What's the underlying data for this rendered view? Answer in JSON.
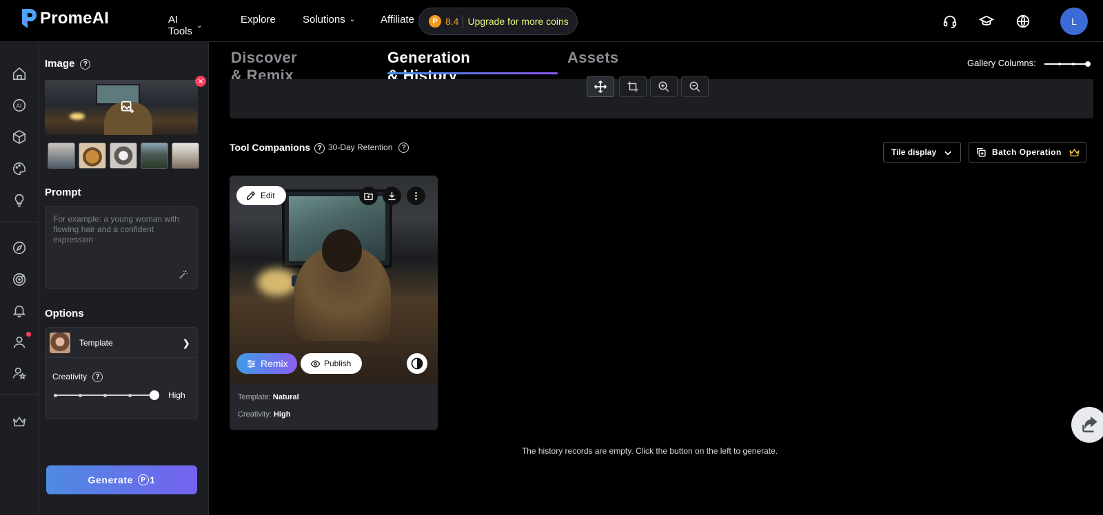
{
  "brand": {
    "name": "PromeAI"
  },
  "nav": {
    "items": [
      {
        "label": "AI Tools",
        "has_dropdown": true
      },
      {
        "label": "Explore",
        "has_dropdown": false
      },
      {
        "label": "Solutions",
        "has_dropdown": true
      },
      {
        "label": "Affiliate",
        "has_dropdown": false
      }
    ],
    "coins": "8.4",
    "upgrade_label": "Upgrade for more coins",
    "icons": [
      "headset-icon",
      "graduation-cap-icon",
      "globe-icon"
    ],
    "avatar_initial": "L"
  },
  "rail": {
    "icons": [
      "home-icon",
      "ai-icon",
      "cube-icon",
      "palette-icon",
      "lightbulb-icon",
      "compass-icon",
      "target-icon",
      "bell-icon",
      "user-icon",
      "user-star-icon",
      "crown-icon"
    ]
  },
  "panel": {
    "image_title": "Image",
    "prompt_title": "Prompt",
    "prompt_placeholder": "For example: a young woman with flowing hair and a confident expression",
    "options_title": "Options",
    "template_label": "Template",
    "creativity_label": "Creativity",
    "creativity_value": "High",
    "creativity_level": 1.0,
    "generate_label": "Generate",
    "generate_cost": "1"
  },
  "main": {
    "tabs": [
      {
        "label": "Discover & Remix",
        "active": false
      },
      {
        "label": "Generation & History",
        "active": true
      },
      {
        "label": "Assets",
        "active": false
      }
    ],
    "gallery_columns_label": "Gallery Columns:",
    "toolbar_icons": [
      "move-icon",
      "crop-icon",
      "zoom-in-icon",
      "zoom-out-icon"
    ],
    "companions_label": "Tool Companions",
    "retention_label": "30-Day Retention",
    "tile_display_label": "Tile display",
    "batch_label": "Batch Operation",
    "card": {
      "edit_label": "Edit",
      "remix_label": "Remix",
      "publish_label": "Publish",
      "template_key": "Template:",
      "template_value": "Natural",
      "creativity_key": "Creativity:",
      "creativity_value": "High"
    },
    "empty_message": "The history records are empty. Click the button on the left to generate."
  },
  "colors": {
    "accent_gradient_start": "#4d8be0",
    "accent_gradient_end": "#7462f0",
    "upgrade_text": "#e6f37a",
    "coin": "#f39c23",
    "close_badge": "#ff3b5c"
  }
}
